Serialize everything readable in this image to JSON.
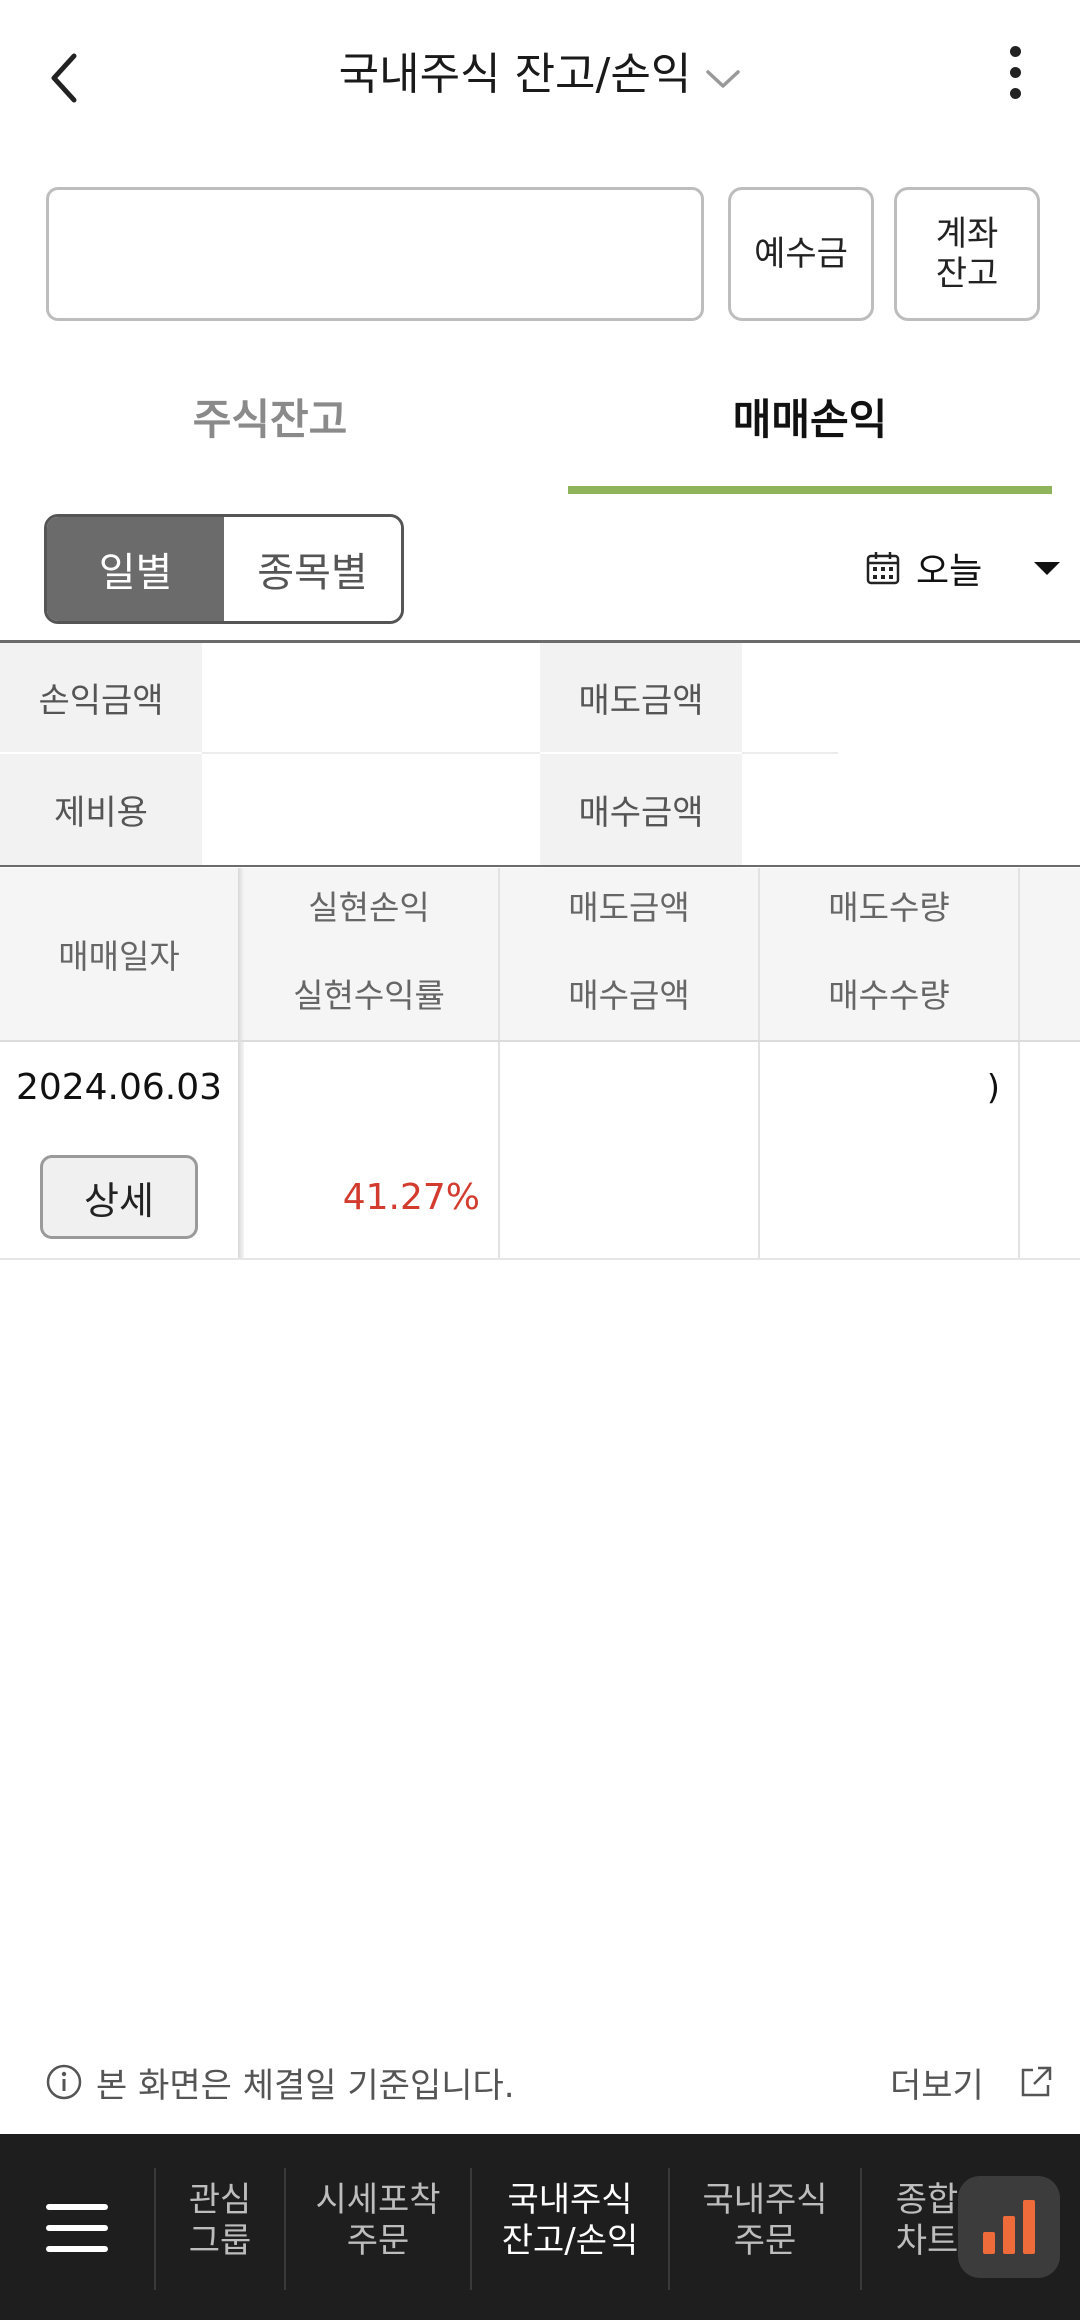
{
  "header": {
    "title": "국내주식 잔고/손익"
  },
  "account": {
    "input_value": "",
    "deposit_button": "예수금",
    "balance_button_line1": "계좌",
    "balance_button_line2": "잔고"
  },
  "tabs": [
    {
      "label": "주식잔고",
      "selected": false
    },
    {
      "label": "매매손익",
      "selected": true
    }
  ],
  "segment": {
    "options": [
      "일별",
      "종목별"
    ],
    "selected": "일별"
  },
  "date_filter": {
    "value": "오늘"
  },
  "summary": {
    "labels": [
      "손익금액",
      "제비용",
      "매도금액",
      "매수금액"
    ]
  },
  "table": {
    "headers": {
      "date": "매매일자",
      "col1_top": "실현손익",
      "col1_bottom": "실현수익률",
      "col2_top": "매도금액",
      "col2_bottom": "매수금액",
      "col3_top": "매도수량",
      "col3_bottom": "매수수량"
    },
    "rows": [
      {
        "date": "2024.06.03",
        "detail_button": "상세",
        "rate": "41.27%",
        "qty_fragment": ")"
      }
    ]
  },
  "footer": {
    "note": "본 화면은 체결일 기준입니다.",
    "more": "더보기"
  },
  "bottom_nav": {
    "items": [
      {
        "line1": "관심",
        "line2": "그룹"
      },
      {
        "line1": "시세포착",
        "line2": "주문"
      },
      {
        "line1": "국내주식",
        "line2": "잔고/손익"
      },
      {
        "line1": "국내주식",
        "line2": "주문"
      },
      {
        "line1": "종합",
        "line2": "차트"
      }
    ],
    "active_index": 2
  },
  "colors": {
    "accent_underline": "#8fb35a",
    "profit_red": "#d23b2e",
    "nav_bg": "#1e1e1e",
    "fab_bars": "#f06b3a"
  }
}
